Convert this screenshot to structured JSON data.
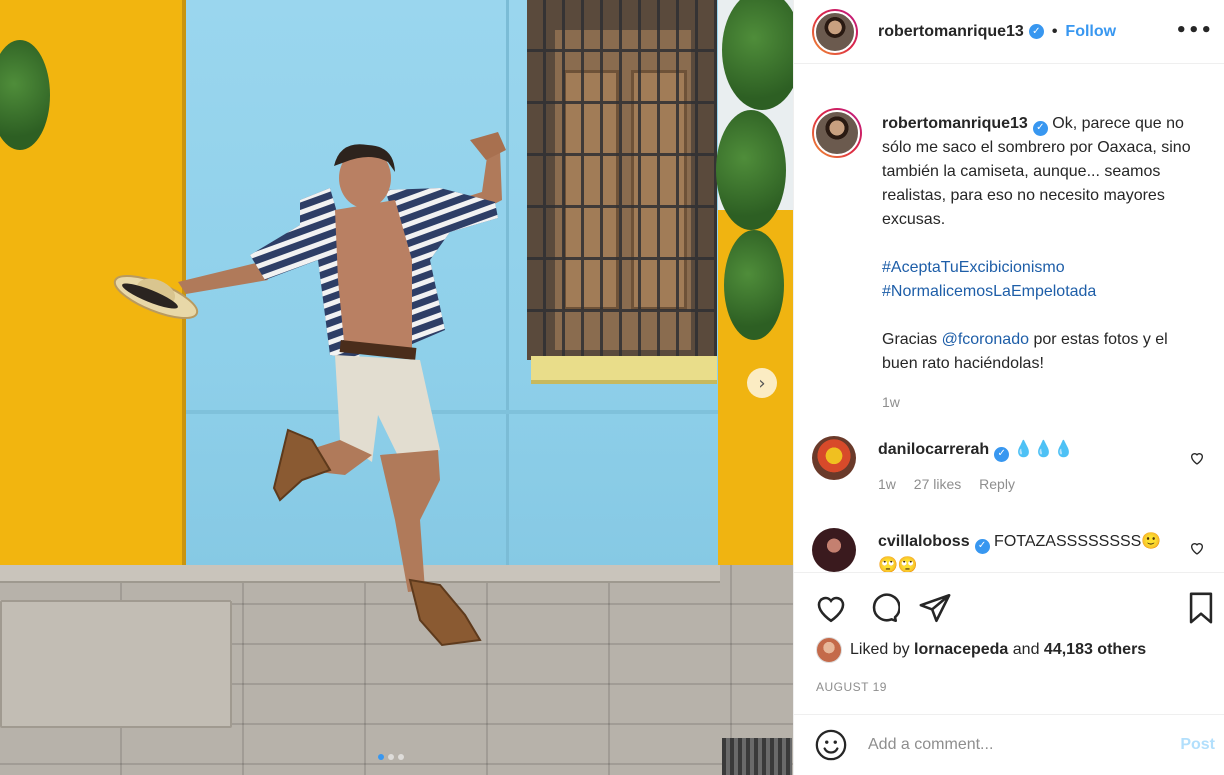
{
  "header": {
    "username": "robertomanrique13",
    "separator": "•",
    "follow_label": "Follow",
    "more_label": "•••"
  },
  "caption": {
    "username": "robertomanrique13",
    "text": "Ok, parece que no sólo me saco el sombrero por Oaxaca, sino también la camiseta, aunque... seamos realistas, para eso no necesito mayores excusas.",
    "hashtags": [
      "#AceptaTuExcibicionismo",
      "#NormalicemosLaEmpelotada"
    ],
    "thanks_prefix": "Gracias",
    "mention": "@fcoronado",
    "thanks_suffix": "por estas fotos y el buen rato haciéndolas!",
    "time": "1w"
  },
  "comments": [
    {
      "username": "danilocarrerah",
      "text": "💧💧💧",
      "time": "1w",
      "likes": "27 likes",
      "reply": "Reply"
    },
    {
      "username": "cvillaloboss",
      "text": "FOTAZASSSSSSSS🙂🙄🙄"
    }
  ],
  "likes": {
    "prefix": "Liked by",
    "user": "lornacepeda",
    "connector": "and",
    "others": "44,183 others"
  },
  "date": "AUGUST 19",
  "comment_box": {
    "placeholder": "Add a comment...",
    "post_label": "Post"
  },
  "carousel": {
    "next_label": "›",
    "dot_count": 3,
    "active_dot": 1
  },
  "colors": {
    "accent": "#3897f0",
    "post_disabled": "#b2dffc",
    "hashtag": "#1e5ea8",
    "muted": "#8e8e8e"
  },
  "icons": [
    "heart-icon",
    "comment-icon",
    "share-icon",
    "bookmark-icon",
    "smiley-icon",
    "verified-icon",
    "more-icon",
    "chevron-right-icon"
  ]
}
